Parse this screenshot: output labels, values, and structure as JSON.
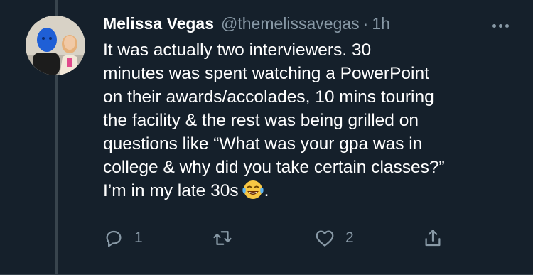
{
  "tweet": {
    "author_name": "Melissa Vegas",
    "author_handle": "@themelissavegas",
    "separator": "·",
    "timestamp": "1h",
    "text": "It was actually two interviewers. 30\nminutes was spent watching a PowerPoint\non their awards/accolades, 10 mins touring\nthe facility & the rest was being grilled on\nquestions like “What was your gpa was in\ncollege & why did you take certain classes?”\nI’m in my late 30s",
    "text_end": ".",
    "emoji": "face-with-tears-of-joy-icon"
  },
  "actions": {
    "reply_count": "1",
    "retweet_count": "",
    "like_count": "2"
  },
  "colors": {
    "background": "#15202b",
    "text": "#ffffff",
    "secondary": "#8899a6",
    "divider": "#38444d"
  }
}
